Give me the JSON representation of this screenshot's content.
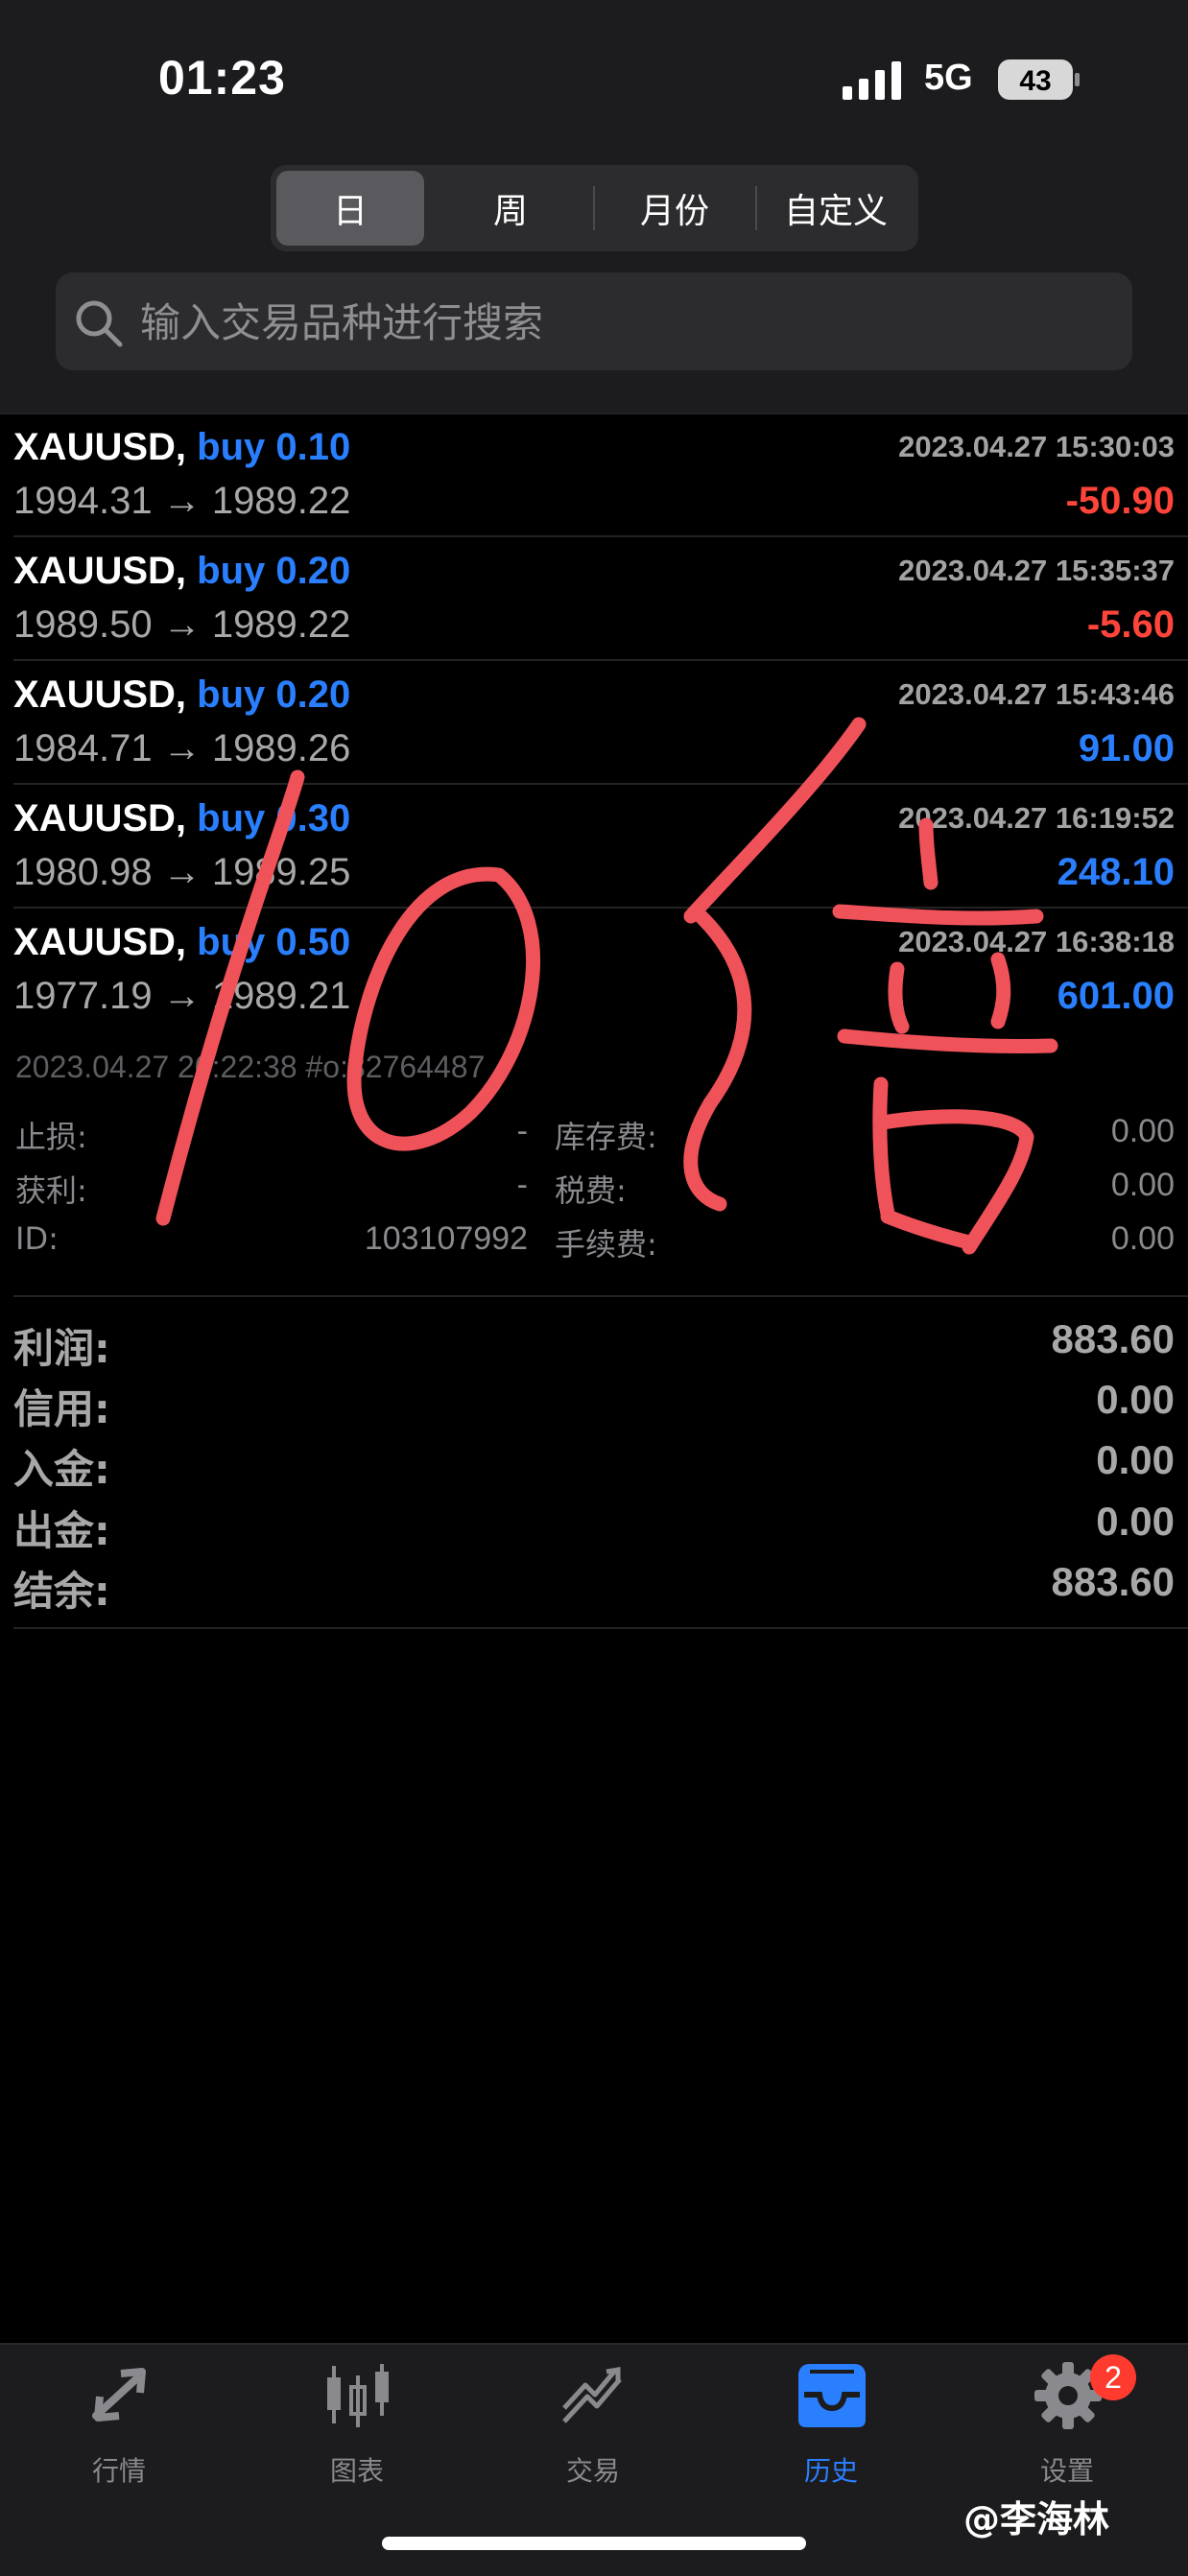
{
  "status_bar": {
    "time": "01:23",
    "network": "5G",
    "battery": "43"
  },
  "period_tabs": [
    "日",
    "周",
    "月份",
    "自定义"
  ],
  "active_period": "日",
  "search": {
    "placeholder": "输入交易品种进行搜索"
  },
  "deals": [
    {
      "symbol": "XAUUSD,",
      "action": "buy 0.10",
      "datetime": "2023.04.27 15:30:03",
      "prices": "1994.31 → 1989.22",
      "profit": "-50.90",
      "profit_sign": "negative"
    },
    {
      "symbol": "XAUUSD,",
      "action": "buy 0.20",
      "datetime": "2023.04.27 15:35:37",
      "prices": "1989.50 → 1989.22",
      "profit": "-5.60",
      "profit_sign": "negative"
    },
    {
      "symbol": "XAUUSD,",
      "action": "buy 0.20",
      "datetime": "2023.04.27 15:43:46",
      "prices": "1984.71 → 1989.26",
      "profit": "91.00",
      "profit_sign": "positive"
    },
    {
      "symbol": "XAUUSD,",
      "action": "buy 0.30",
      "datetime": "2023.04.27 16:19:52",
      "prices": "1980.98 → 1989.25",
      "profit": "248.10",
      "profit_sign": "positive"
    },
    {
      "symbol": "XAUUSD,",
      "action": "buy 0.50",
      "datetime": "2023.04.27 16:38:18",
      "prices": "1977.19 → 1989.21",
      "profit": "601.00",
      "profit_sign": "positive"
    }
  ],
  "detail": {
    "line": "2023.04.27 20:22:38  #o:32764487",
    "stop_loss_label": "止损:",
    "stop_loss_value": "-",
    "take_profit_label": "获利:",
    "take_profit_value": "-",
    "id_label": "ID:",
    "id_value": "103107992",
    "swap_label": "库存费:",
    "swap_value": "0.00",
    "tax_label": "税费:",
    "tax_value": "0.00",
    "commission_label": "手续费:",
    "commission_value": "0.00"
  },
  "summary": [
    {
      "label": "利润:",
      "value": "883.60"
    },
    {
      "label": "信用:",
      "value": "0.00"
    },
    {
      "label": "入金:",
      "value": "0.00"
    },
    {
      "label": "出金:",
      "value": "0.00"
    },
    {
      "label": "结余:",
      "value": "883.60"
    }
  ],
  "handwritten_annotation": "10倍",
  "bottom_tabs": [
    {
      "label": "行情",
      "icon": "quotes-arrows-icon"
    },
    {
      "label": "图表",
      "icon": "candlestick-chart-icon"
    },
    {
      "label": "交易",
      "icon": "trade-chart-icon"
    },
    {
      "label": "历史",
      "icon": "history-inbox-icon"
    },
    {
      "label": "设置",
      "icon": "settings-gear-icon"
    }
  ],
  "active_bottom_tab": "历史",
  "settings_badge": "2",
  "watermark": "@李海林",
  "colors": {
    "negative": "#ff453a",
    "positive": "#2a7fff",
    "handwriting": "#f0525a",
    "background": "#000000"
  }
}
